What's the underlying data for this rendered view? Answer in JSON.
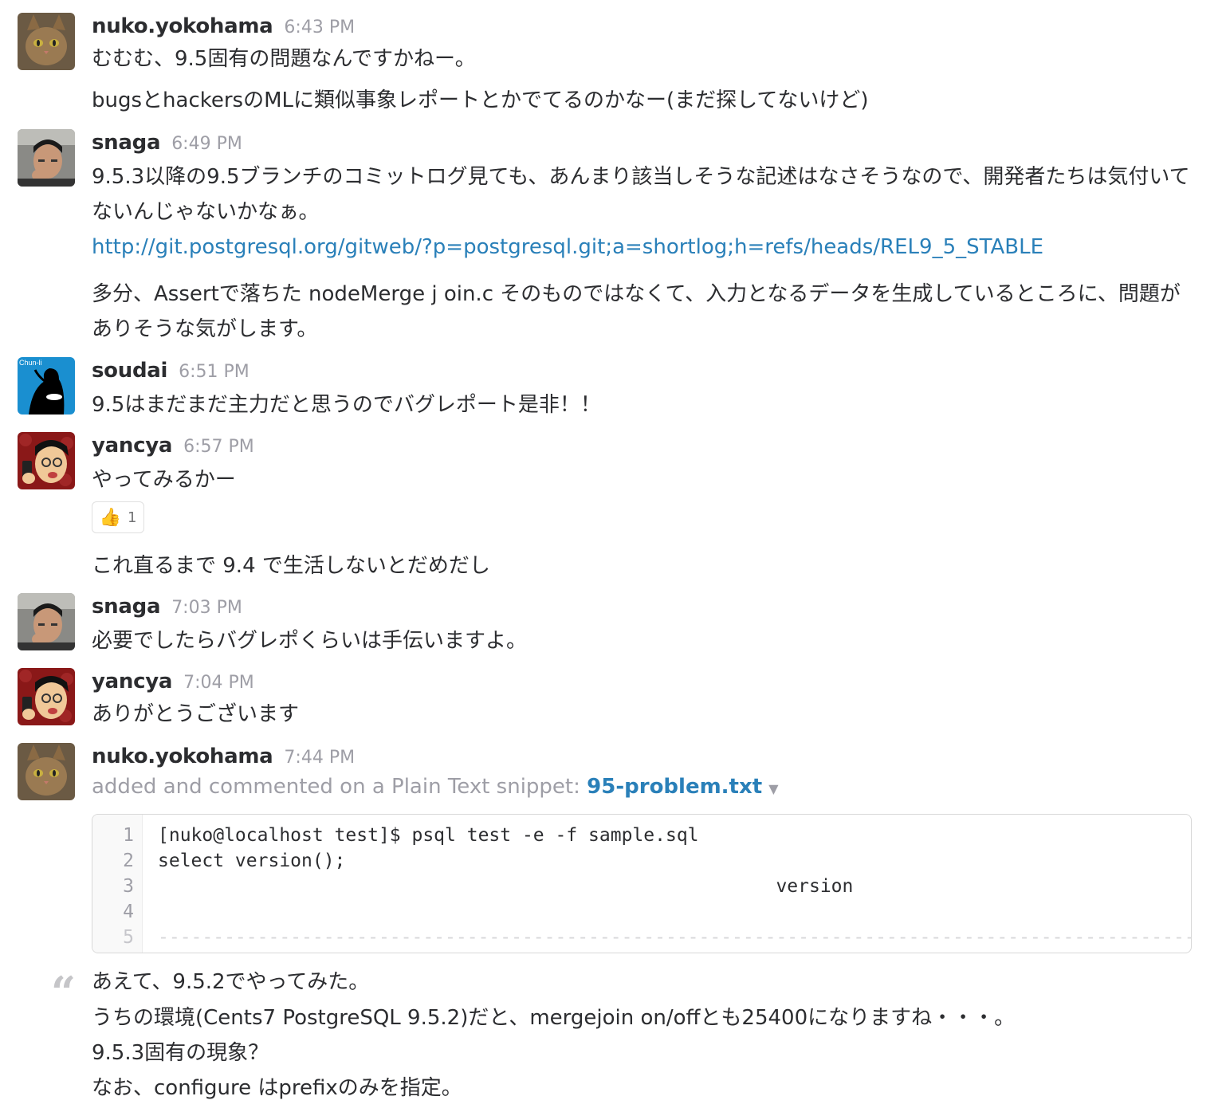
{
  "messages": [
    {
      "author": "nuko.yokohama",
      "time": "6:43 PM",
      "avatar": "cat-avatar",
      "lines": [
        "むむむ、9.5固有の問題なんですかねー。",
        "bugsとhackersのMLに類似事象レポートとかでてるのかなー(まだ探してないけど)"
      ]
    },
    {
      "author": "snaga",
      "time": "6:49 PM",
      "avatar": "man-avatar",
      "lines": [
        "9.5.3以降の9.5ブランチのコミットログ見ても、あんまり該当しそうな記述はなさそうなので、開発者たちは気付いてないんじゃないかなぁ。"
      ],
      "link": "http://git.postgresql.org/gitweb/?p=postgresql.git;a=shortlog;h=refs/heads/REL9_5_STABLE",
      "extra": "多分、Assertで落ちた nodeMerge j oin.c そのものではなくて、入力となるデータを生成しているところに、問題がありそうな気がします。"
    },
    {
      "author": "soudai",
      "time": "6:51 PM",
      "avatar": "chun-li-avatar",
      "avatar_text": "Chun-li",
      "lines": [
        "9.5はまだまだ主力だと思うのでバグレポート是非！！"
      ]
    },
    {
      "author": "yancya",
      "time": "6:57 PM",
      "avatar": "cartoon-avatar",
      "lines": [
        "やってみるかー"
      ],
      "reaction": {
        "emoji": "👍",
        "count": "1"
      },
      "after_reaction": "これ直るまで 9.4 で生活しないとだめだし"
    },
    {
      "author": "snaga",
      "time": "7:03 PM",
      "avatar": "man-avatar",
      "lines": [
        "必要でしたらバグレポくらいは手伝いますよ。"
      ]
    },
    {
      "author": "yancya",
      "time": "7:04 PM",
      "avatar": "cartoon-avatar",
      "lines": [
        "ありがとうございます"
      ]
    },
    {
      "author": "nuko.yokohama",
      "time": "7:44 PM",
      "avatar": "cat-avatar",
      "snippet_meta": "added and commented on a Plain Text snippet: ",
      "snippet_name": "95-problem.txt",
      "snippet_lines": [
        {
          "num": "1",
          "text": "[nuko@localhost test]$ psql test -e -f sample.sql"
        },
        {
          "num": "2",
          "text": "select version();"
        },
        {
          "num": "3",
          "text": "                                                        version"
        },
        {
          "num": "4",
          "text": ""
        },
        {
          "num": "5",
          "text": "---------------------------------------------------------------------------------------------------------"
        }
      ],
      "comment": [
        "あえて、9.5.2でやってみた。",
        "うちの環境(Cents7 PostgreSQL 9.5.2)だと、mergejoin on/offとも25400になりますね・・・。",
        "9.5.3固有の現象？",
        "なお、configure はprefixのみを指定。"
      ]
    }
  ],
  "colors": {
    "link": "#2a80b9",
    "timestamp": "#9e9ea6",
    "text": "#2c2d30"
  }
}
